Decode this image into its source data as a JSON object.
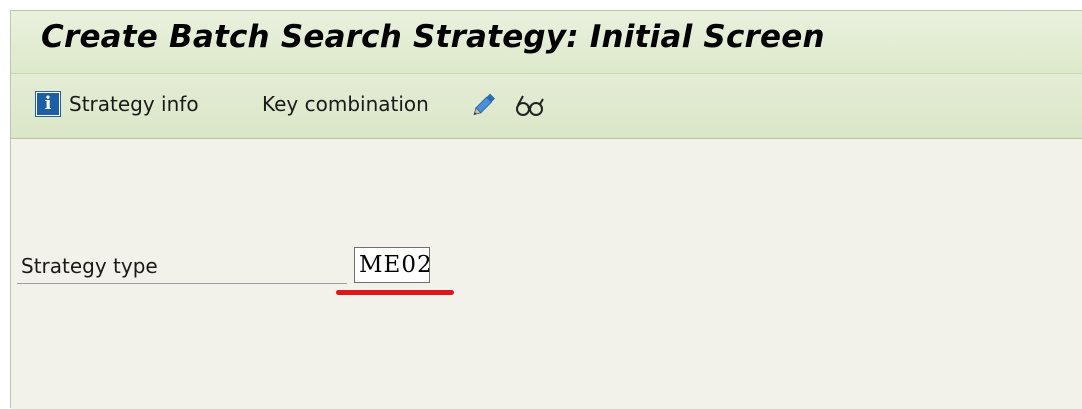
{
  "window": {
    "title": "Create Batch Search Strategy: Initial Screen"
  },
  "toolbar": {
    "strategy_info_label": "Strategy info",
    "info_icon_glyph": "i",
    "key_combination_label": "Key combination",
    "icons": [
      "info-icon",
      "pencil-icon",
      "glasses-icon"
    ]
  },
  "form": {
    "strategy_type_label": "Strategy type",
    "strategy_type_value": "ME02"
  },
  "colors": {
    "title_bar": "#dde9cb",
    "toolbar": "#dbe6c8",
    "content_bg": "#f2f2ea",
    "info_icon_blue": "#1d5fa6",
    "pencil_blue": "#3b82c8",
    "highlight_red": "#e0161b"
  }
}
